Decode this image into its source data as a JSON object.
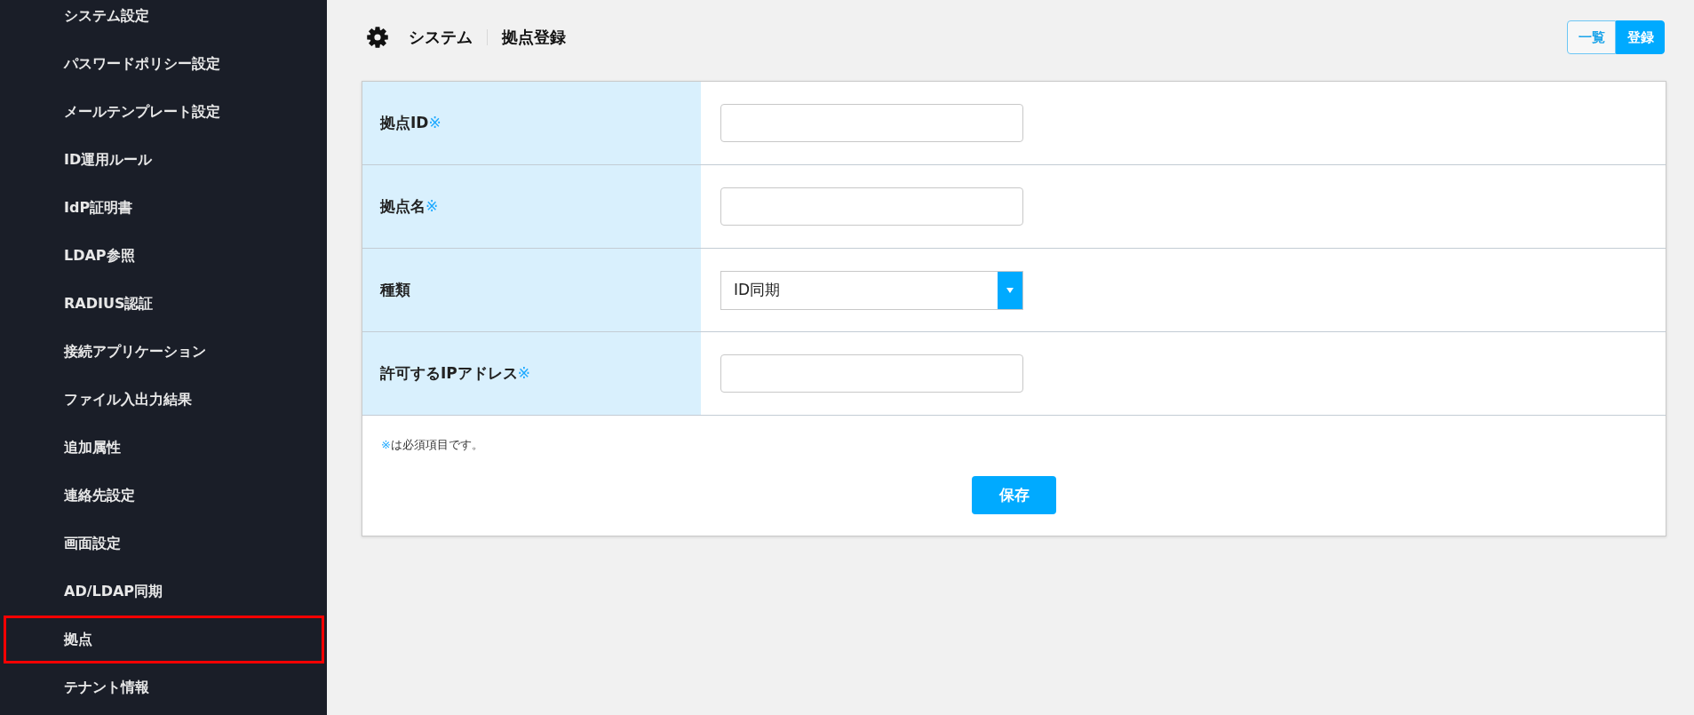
{
  "sidebar": {
    "items": [
      {
        "label": "システム設定",
        "selected": false
      },
      {
        "label": "パスワードポリシー設定",
        "selected": false
      },
      {
        "label": "メールテンプレート設定",
        "selected": false
      },
      {
        "label": "ID運用ルール",
        "selected": false
      },
      {
        "label": "IdP証明書",
        "selected": false
      },
      {
        "label": "LDAP参照",
        "selected": false
      },
      {
        "label": "RADIUS認証",
        "selected": false
      },
      {
        "label": "接続アプリケーション",
        "selected": false
      },
      {
        "label": "ファイル入出力結果",
        "selected": false
      },
      {
        "label": "追加属性",
        "selected": false
      },
      {
        "label": "連絡先設定",
        "selected": false
      },
      {
        "label": "画面設定",
        "selected": false
      },
      {
        "label": "AD/LDAP同期",
        "selected": false
      },
      {
        "label": "拠点",
        "selected": true
      },
      {
        "label": "テナント情報",
        "selected": false
      }
    ]
  },
  "header": {
    "breadcrumb": [
      "システム",
      "拠点登録"
    ],
    "actions": [
      {
        "label": "一覧",
        "selected": false
      },
      {
        "label": "登録",
        "selected": true
      }
    ]
  },
  "form": {
    "fields": [
      {
        "kind": "text",
        "label": "拠点ID",
        "required_mark": "※"
      },
      {
        "kind": "text",
        "label": "拠点名",
        "required_mark": "※"
      },
      {
        "kind": "select",
        "label": "種類",
        "value": "ID同期"
      },
      {
        "kind": "text",
        "label": "許可するIPアドレス",
        "required_mark": "※"
      }
    ],
    "note": {
      "mark": "※",
      "text": "は必須項目です。"
    },
    "submit": "保存"
  }
}
